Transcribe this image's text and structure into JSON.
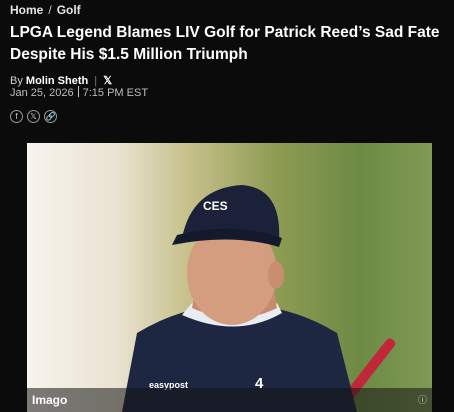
{
  "breadcrumb": {
    "home": "Home",
    "separator": "/",
    "section": "Golf"
  },
  "article": {
    "title": "LPGA Legend Blames LIV Golf for Patrick Reed’s Sad Fate Despite His $1.5 Million Triumph",
    "byline_prefix": "By",
    "author": "Molin Sheth",
    "author_social": "𝕏",
    "date": "Jan 25, 2026",
    "time": "7:15 PM EST"
  },
  "share": {
    "facebook": "f",
    "x": "𝕏",
    "link": "🔗"
  },
  "image": {
    "credit": "Imago",
    "info": "ⓘ",
    "cap_logo": "CES",
    "shirt_logo": "easypost",
    "chest_logo": "4"
  }
}
